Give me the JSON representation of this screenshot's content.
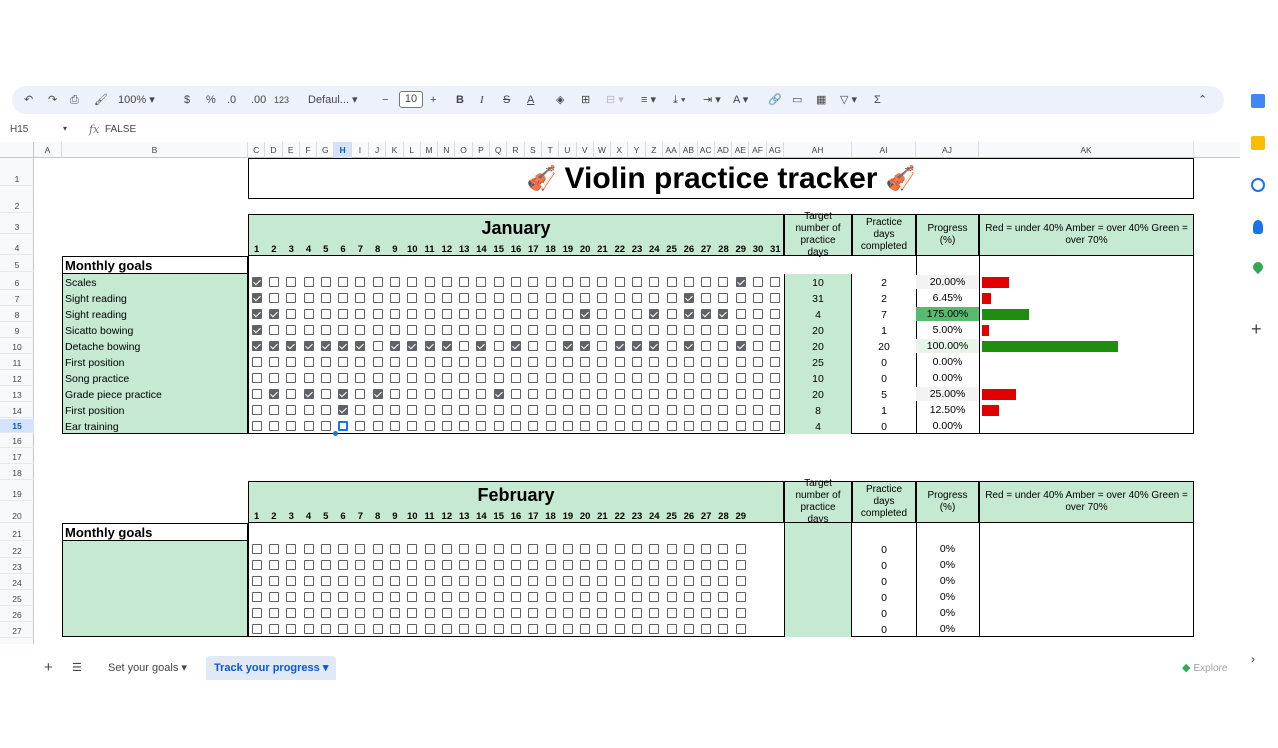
{
  "toolbar": {
    "zoom": "100%",
    "currency": "$",
    "percent": "%",
    "decrease_decimal": ".0",
    "increase_decimal": ".00",
    "number_format": "123",
    "font": "Defaul...",
    "font_size": "10"
  },
  "formula_bar": {
    "cell_ref": "H15",
    "fx": "fx",
    "value": "FALSE"
  },
  "columns": [
    "A",
    "B",
    "C",
    "D",
    "E",
    "F",
    "G",
    "H",
    "I",
    "J",
    "K",
    "L",
    "M",
    "N",
    "O",
    "P",
    "Q",
    "R",
    "S",
    "T",
    "U",
    "V",
    "W",
    "X",
    "Y",
    "Z",
    "AA",
    "AB",
    "AC",
    "AD",
    "AE",
    "AF",
    "AG",
    "AH",
    "AI",
    "AJ",
    "AK"
  ],
  "rows": [
    "1",
    "2",
    "3",
    "4",
    "5",
    "6",
    "7",
    "8",
    "9",
    "10",
    "11",
    "12",
    "13",
    "14",
    "15",
    "16",
    "17",
    "18",
    "19",
    "20",
    "21",
    "22",
    "23",
    "24",
    "25",
    "26",
    "27"
  ],
  "title": "Violin practice tracker",
  "january": {
    "name": "January",
    "days": [
      "1",
      "2",
      "3",
      "4",
      "5",
      "6",
      "7",
      "8",
      "9",
      "10",
      "11",
      "12",
      "13",
      "14",
      "15",
      "16",
      "17",
      "18",
      "19",
      "20",
      "21",
      "22",
      "23",
      "24",
      "25",
      "26",
      "27",
      "28",
      "29",
      "30",
      "31"
    ],
    "col_target": "Target number of practice days",
    "col_done": "Practice days completed",
    "col_progress": "Progress (%)",
    "legend": "Red = under 40% Amber = over 40% Green = over 70%",
    "goals_label": "Monthly goals",
    "goals": [
      {
        "name": "Scales",
        "target": "10",
        "done": "2",
        "progress": "20.00%",
        "value": 0.2,
        "color": "#e00000",
        "checked": [
          1,
          29
        ]
      },
      {
        "name": "Sight reading",
        "target": "31",
        "done": "2",
        "progress": "6.45%",
        "value": 0.0645,
        "color": "#e00000",
        "checked": [
          1,
          26
        ]
      },
      {
        "name": "Sight reading",
        "target": "4",
        "done": "7",
        "progress": "175.00%",
        "value": 1.75,
        "color": "#1e8e0e",
        "checked": [
          1,
          2,
          20,
          24,
          26,
          27,
          28
        ]
      },
      {
        "name": "Sicatto bowing",
        "target": "20",
        "done": "1",
        "progress": "5.00%",
        "value": 0.05,
        "color": "#e00000",
        "checked": [
          1
        ]
      },
      {
        "name": "Detache bowing",
        "target": "20",
        "done": "20",
        "progress": "100.00%",
        "value": 1.0,
        "color": "#1e8e0e",
        "checked": [
          1,
          2,
          3,
          4,
          5,
          6,
          7,
          9,
          10,
          11,
          12,
          14,
          16,
          19,
          20,
          22,
          23,
          24,
          26,
          29
        ]
      },
      {
        "name": "First position",
        "target": "25",
        "done": "0",
        "progress": "0.00%",
        "value": 0,
        "color": "#e00000",
        "checked": []
      },
      {
        "name": "Song practice",
        "target": "10",
        "done": "0",
        "progress": "0.00%",
        "value": 0,
        "color": "#e00000",
        "checked": []
      },
      {
        "name": "Grade piece practice",
        "target": "20",
        "done": "5",
        "progress": "25.00%",
        "value": 0.25,
        "color": "#e00000",
        "checked": [
          2,
          4,
          6,
          8,
          15
        ]
      },
      {
        "name": "First position",
        "target": "8",
        "done": "1",
        "progress": "12.50%",
        "value": 0.125,
        "color": "#e00000",
        "checked": [
          6
        ]
      },
      {
        "name": "Ear training",
        "target": "4",
        "done": "0",
        "progress": "0.00%",
        "value": 0,
        "color": "#e00000",
        "checked": []
      }
    ]
  },
  "february": {
    "name": "February",
    "days": [
      "1",
      "2",
      "3",
      "4",
      "5",
      "6",
      "7",
      "8",
      "9",
      "10",
      "11",
      "12",
      "13",
      "14",
      "15",
      "16",
      "17",
      "18",
      "19",
      "20",
      "21",
      "22",
      "23",
      "24",
      "25",
      "26",
      "27",
      "28",
      "29"
    ],
    "col_target": "Target number of practice days",
    "col_done": "Practice days completed",
    "col_progress": "Progress (%)",
    "legend": "Red = under 40% Amber = over 40% Green = over 70%",
    "goals_label": "Monthly goals",
    "rows": [
      {
        "done": "0",
        "progress": "0%"
      },
      {
        "done": "0",
        "progress": "0%"
      },
      {
        "done": "0",
        "progress": "0%"
      },
      {
        "done": "0",
        "progress": "0%"
      },
      {
        "done": "0",
        "progress": "0%"
      },
      {
        "done": "0",
        "progress": "0%"
      }
    ]
  },
  "tabs": {
    "add": "+",
    "sheet1": "Set your goals",
    "sheet2": "Track your progress",
    "explore": "Explore"
  },
  "colors": {
    "header_green": "#c6e9d1",
    "selection_blue": "#1a73e8",
    "toolbar_bg": "#edf2fa"
  }
}
